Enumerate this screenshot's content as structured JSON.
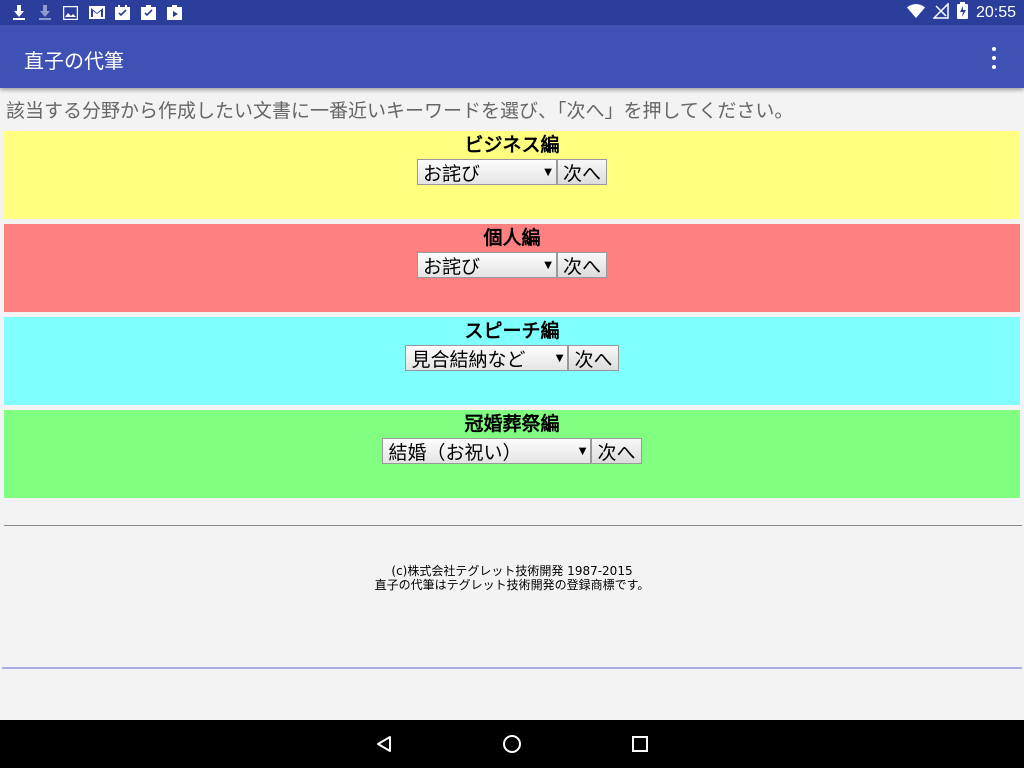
{
  "status_bar": {
    "time": "20:55",
    "left_icons": [
      "download-icon",
      "download-faded-icon",
      "image-icon",
      "gmail-icon",
      "calendar-check-icon",
      "clipboard-check-icon",
      "calendar-play-icon"
    ],
    "right_icons": [
      "wifi-icon",
      "no-signal-icon",
      "battery-charging-icon"
    ]
  },
  "app_bar": {
    "title": "直子の代筆",
    "menu_icon": "more-vert-icon"
  },
  "instruction": "該当する分野から作成したい文書に一番近いキーワードを選び、「次へ」を押してください。",
  "sections": [
    {
      "title": "ビジネス編",
      "selected": "お詫び",
      "button": "次へ",
      "color": "#ffff80"
    },
    {
      "title": "個人編",
      "selected": "お詫び",
      "button": "次へ",
      "color": "#ff8080"
    },
    {
      "title": "スピーチ編",
      "selected": "見合結納など",
      "button": "次へ",
      "color": "#80ffff"
    },
    {
      "title": "冠婚葬祭編",
      "selected": "結婚（お祝い）",
      "button": "次へ",
      "color": "#80ff80"
    }
  ],
  "footer": {
    "copyright": "(c)株式会社テグレット技術開発 1987-2015",
    "trademark": "直子の代筆はテグレット技術開発の登録商標です。"
  },
  "nav_bar": {
    "icons": [
      "back-icon",
      "home-icon",
      "recents-icon"
    ]
  }
}
